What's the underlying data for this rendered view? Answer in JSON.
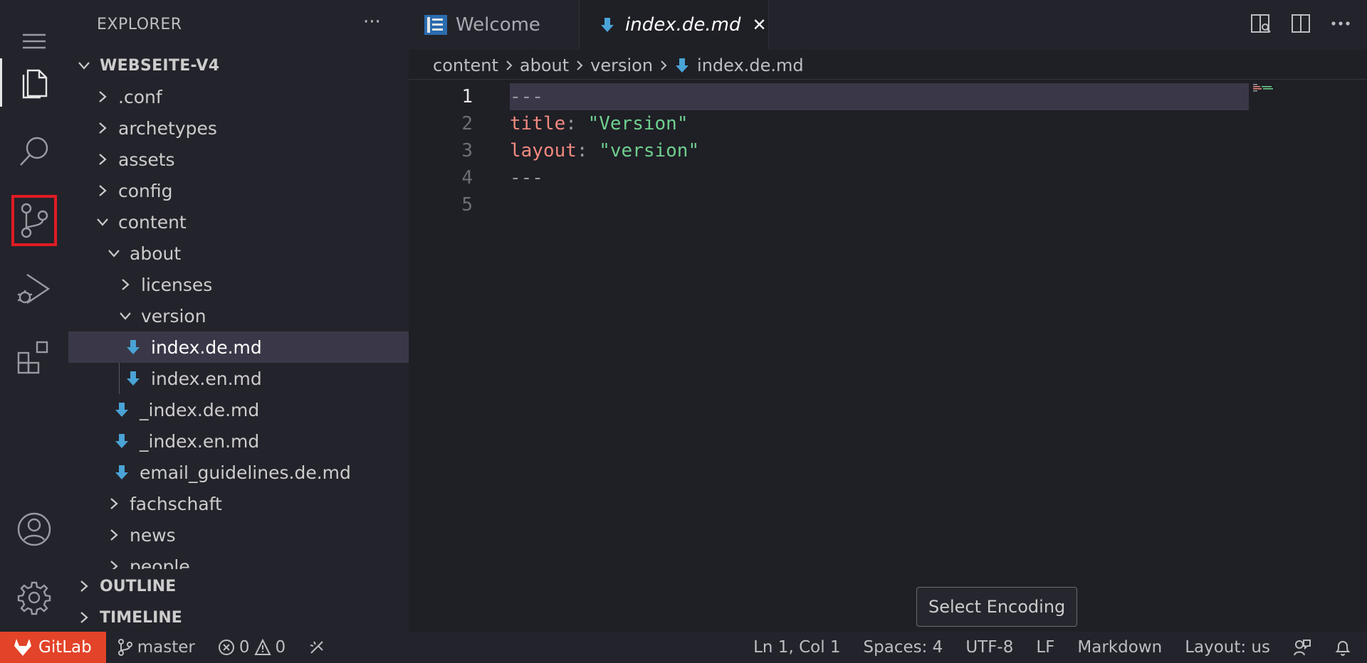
{
  "sidebar": {
    "title": "EXPLORER",
    "more": "···",
    "root": "WEBSEITE-V4",
    "tree": [
      {
        "label": ".conf"
      },
      {
        "label": "archetypes"
      },
      {
        "label": "assets"
      },
      {
        "label": "config"
      },
      {
        "label": "content"
      },
      {
        "label": "about"
      },
      {
        "label": "licenses"
      },
      {
        "label": "version"
      },
      {
        "label": "index.de.md"
      },
      {
        "label": "index.en.md"
      },
      {
        "label": "_index.de.md"
      },
      {
        "label": "_index.en.md"
      },
      {
        "label": "email_guidelines.de.md"
      },
      {
        "label": "fachschaft"
      },
      {
        "label": "news"
      },
      {
        "label": "people"
      }
    ],
    "outline": "OUTLINE",
    "timeline": "TIMELINE"
  },
  "tabs": [
    {
      "label": "Welcome",
      "icon": "welcome-icon"
    },
    {
      "label": "index.de.md",
      "icon": "markdown-icon",
      "close": "✕"
    }
  ],
  "breadcrumb": [
    "content",
    "about",
    "version",
    "index.de.md"
  ],
  "editor": {
    "line_numbers": [
      "1",
      "2",
      "3",
      "4",
      "5"
    ],
    "lines": [
      {
        "text": "---"
      },
      {
        "key": "title",
        "sep": ": ",
        "value": "\"Version\""
      },
      {
        "key": "layout",
        "sep": ": ",
        "value": "\"version\""
      },
      {
        "text": "---"
      },
      {
        "text": ""
      }
    ]
  },
  "tooltip": "Select Encoding",
  "status": {
    "gitlab": "GitLab",
    "branch": "master",
    "errors": "0",
    "warnings": "0",
    "position": "Ln 1, Col 1",
    "spaces": "Spaces: 4",
    "encoding": "UTF-8",
    "eol": "LF",
    "language": "Markdown",
    "layout": "Layout: us"
  },
  "colors": {
    "accent_gitlab": "#e24329",
    "focus_highlight": "#e01b24",
    "markdown_icon": "#4aa3d6",
    "yaml_key": "#f08a7e",
    "yaml_string": "#6fcf8e"
  }
}
